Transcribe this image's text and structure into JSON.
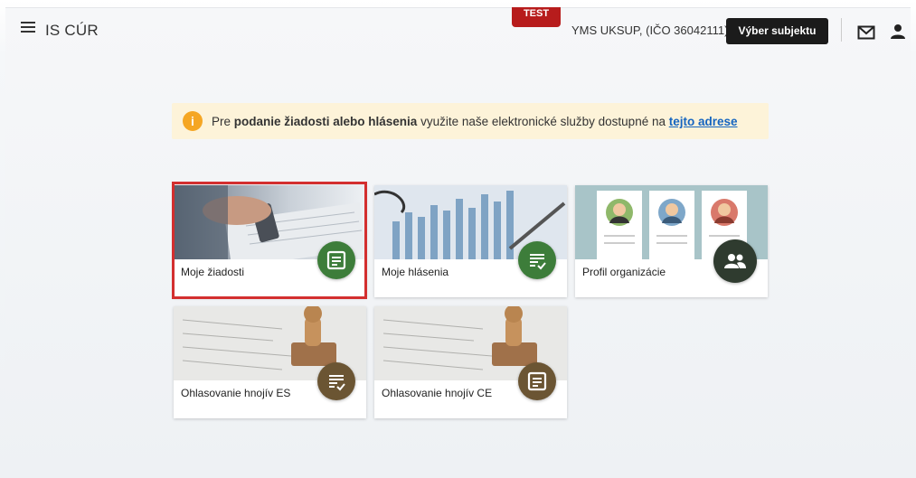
{
  "header": {
    "app_title": "IS CÚR",
    "env_badge": "TEST",
    "subject": "YMS UKSUP, (IČO 36042111)",
    "select_subject_label": "Výber subjektu",
    "menu_icon": "hamburger-icon",
    "mail_icon": "mail-icon",
    "user_icon": "person-icon"
  },
  "notice": {
    "icon": "info-icon",
    "prefix": "Pre ",
    "bold": "podanie žiadosti alebo hlásenia",
    "middle": " využite naše elektronické služby dostupné na ",
    "link": "tejto adrese"
  },
  "tiles": [
    {
      "label": "Moje žiadosti",
      "icon": "form-icon",
      "color": "#3d7d3a",
      "selected": true
    },
    {
      "label": "Moje hlásenia",
      "icon": "checklist-icon",
      "color": "#3d7d3a"
    },
    {
      "label": "Profil organizácie",
      "icon": "group-icon",
      "color": "#2f3b2f"
    },
    {
      "label": "Ohlasovanie hnojív ES",
      "icon": "checklist-icon",
      "color": "#6b5533"
    },
    {
      "label": "Ohlasovanie hnojív CE",
      "icon": "form-icon",
      "color": "#6b5533"
    }
  ]
}
